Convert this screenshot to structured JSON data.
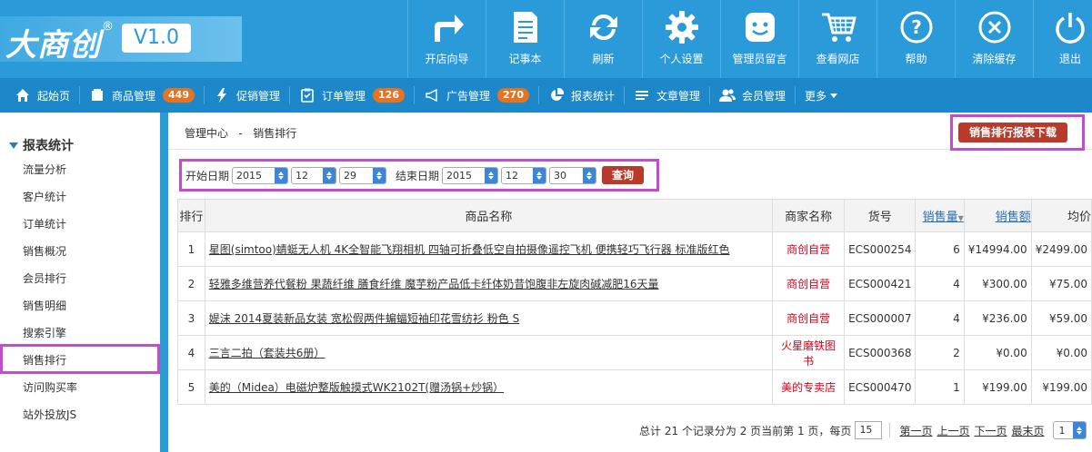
{
  "header": {
    "logo_text": "大商创",
    "logo_reg": "®",
    "version": "V1.0",
    "tools": [
      {
        "label": "开店向导",
        "icon": "share-arrow-icon"
      },
      {
        "label": "记事本",
        "icon": "notepad-icon"
      },
      {
        "label": "刷新",
        "icon": "refresh-icon"
      },
      {
        "label": "个人设置",
        "icon": "gear-icon"
      },
      {
        "label": "管理员留言",
        "icon": "message-face-icon"
      },
      {
        "label": "查看网店",
        "icon": "cart-icon"
      },
      {
        "label": "帮助",
        "icon": "help-icon"
      },
      {
        "label": "清除缓存",
        "icon": "clear-cache-icon"
      },
      {
        "label": "退出",
        "icon": "power-icon"
      }
    ]
  },
  "nav": {
    "items": [
      {
        "label": "起始页",
        "icon": "home-icon"
      },
      {
        "label": "商品管理",
        "icon": "goods-icon",
        "badge": "449"
      },
      {
        "label": "促销管理",
        "icon": "lightning-icon"
      },
      {
        "label": "订单管理",
        "icon": "order-icon",
        "badge": "126"
      },
      {
        "label": "广告管理",
        "icon": "megaphone-icon",
        "badge": "270"
      },
      {
        "label": "报表统计",
        "icon": "pie-chart-icon"
      },
      {
        "label": "文章管理",
        "icon": "list-icon"
      },
      {
        "label": "会员管理",
        "icon": "users-icon"
      }
    ],
    "more_label": "更多"
  },
  "sidebar": {
    "title": "报表统计",
    "items": [
      "流量分析",
      "客户统计",
      "订单统计",
      "销售概况",
      "会员排行",
      "销售明细",
      "搜索引擎",
      "销售排行",
      "访问购买率",
      "站外投放JS"
    ],
    "active_index": 7
  },
  "breadcrumb": {
    "root": "管理中心",
    "separator": "-",
    "current": "销售排行"
  },
  "download_button": "销售排行报表下载",
  "filter": {
    "start_label": "开始日期",
    "start_year": "2015",
    "start_month": "12",
    "start_day": "29",
    "end_label": "结束日期",
    "end_year": "2015",
    "end_month": "12",
    "end_day": "30",
    "query_button": "查询"
  },
  "table": {
    "headers": [
      "排行",
      "商品名称",
      "商家名称",
      "货号",
      "销售量",
      "销售额",
      "均价"
    ],
    "rows": [
      {
        "rank": "1",
        "name": "星图(simtoo)蜻蜓无人机 4K全智能飞翔相机 四轴可折叠低空自拍摄像遥控飞机 便携轻巧飞行器 标准版红色",
        "shop": "商创自营",
        "sku": "ECS000254",
        "qty": "6",
        "amount": "¥14994.00",
        "avg": "¥2499.00"
      },
      {
        "rank": "2",
        "name": "轻雅多维营养代餐粉 果蔬纤维 膳食纤维 魔芋粉产品低卡纤体奶昔饱腹非左旋肉碱减肥16天量",
        "shop": "商创自营",
        "sku": "ECS000421",
        "qty": "4",
        "amount": "¥300.00",
        "avg": "¥75.00"
      },
      {
        "rank": "3",
        "name": "媞沫 2014夏装新品女装 宽松假两件蝙蝠短袖印花雪纺衫 粉色 S",
        "shop": "商创自营",
        "sku": "ECS000007",
        "qty": "4",
        "amount": "¥236.00",
        "avg": "¥59.00"
      },
      {
        "rank": "4",
        "name": "三言二拍（套装共6册）",
        "shop": "火星磨铁图书",
        "sku": "ECS000368",
        "qty": "2",
        "amount": "¥0.00",
        "avg": "¥0.00"
      },
      {
        "rank": "5",
        "name": "美的（Midea）电磁炉整版触摸式WK2102T(赠汤锅+炒锅）",
        "shop": "美的专卖店",
        "sku": "ECS000470",
        "qty": "1",
        "amount": "¥199.00",
        "avg": "¥199.00"
      }
    ]
  },
  "pager": {
    "summary": "总计 21 个记录分为 2 页当前第 1 页，每页",
    "per_page": "15",
    "first": "第一页",
    "prev": "上一页",
    "next": "下一页",
    "last": "最末页",
    "page_select": "1"
  },
  "colors": {
    "header_bg": "#2a9ad8",
    "nav_bg": "#1c87c9",
    "badge": "#e8731f",
    "button_red": "#b83a2b",
    "shop_red": "#d0021b",
    "highlight": "#c44bd0"
  }
}
